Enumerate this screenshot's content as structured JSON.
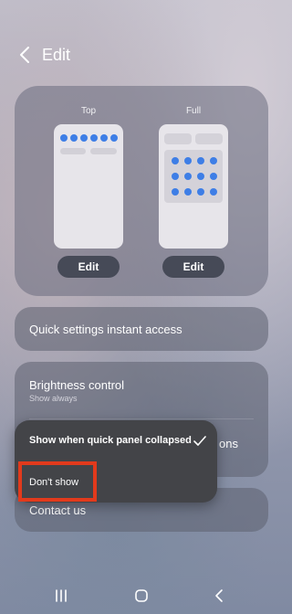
{
  "header": {
    "title": "Edit"
  },
  "layouts": [
    {
      "label": "Top",
      "edit_label": "Edit"
    },
    {
      "label": "Full",
      "edit_label": "Edit"
    }
  ],
  "quick_settings": {
    "label": "Quick settings instant access"
  },
  "brightness": {
    "title": "Brightness control",
    "subtitle": "Show always"
  },
  "behind_text": "ons",
  "contact": {
    "label": "Contact us"
  },
  "menu": {
    "option_selected": "Show when quick panel collapsed",
    "option_other": "Don't show"
  },
  "colors": {
    "accent_dot": "#3e7ee6",
    "highlight": "#e23a1c"
  },
  "icons": [
    "back-arrow-icon",
    "checkmark-icon",
    "recent-apps-icon",
    "home-icon",
    "back-icon"
  ]
}
